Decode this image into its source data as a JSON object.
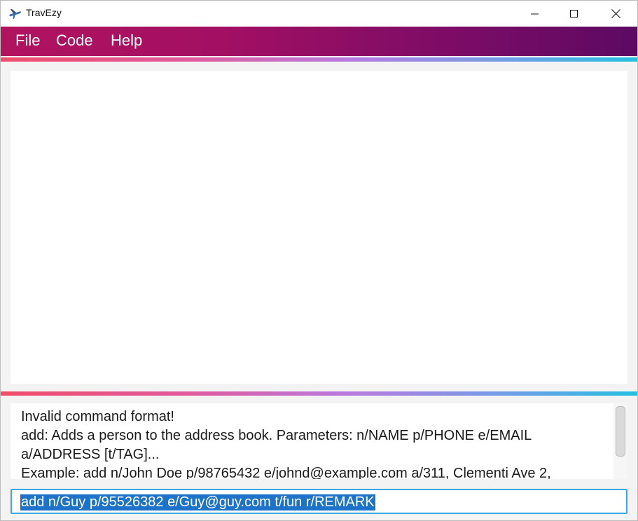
{
  "window": {
    "title": "TravEzy",
    "icon": "airplane-icon"
  },
  "menu": {
    "file": "File",
    "code": "Code",
    "help": "Help"
  },
  "result": {
    "lines": [
      "Invalid command format!",
      "add: Adds a person to the address book. Parameters: n/NAME p/PHONE e/EMAIL a/ADDRESS [t/TAG]...",
      "Example: add n/John Doe p/98765432 e/johnd@example.com a/311, Clementi Ave 2,"
    ]
  },
  "command": {
    "value": "add n/Guy p/95526382 e/Guy@guy.com t/fun r/REMARK"
  },
  "colors": {
    "menubar_start": "#b1135f",
    "menubar_end": "#5c0a63",
    "accent_border": "#39a7e3",
    "selection": "#1c73c9"
  }
}
